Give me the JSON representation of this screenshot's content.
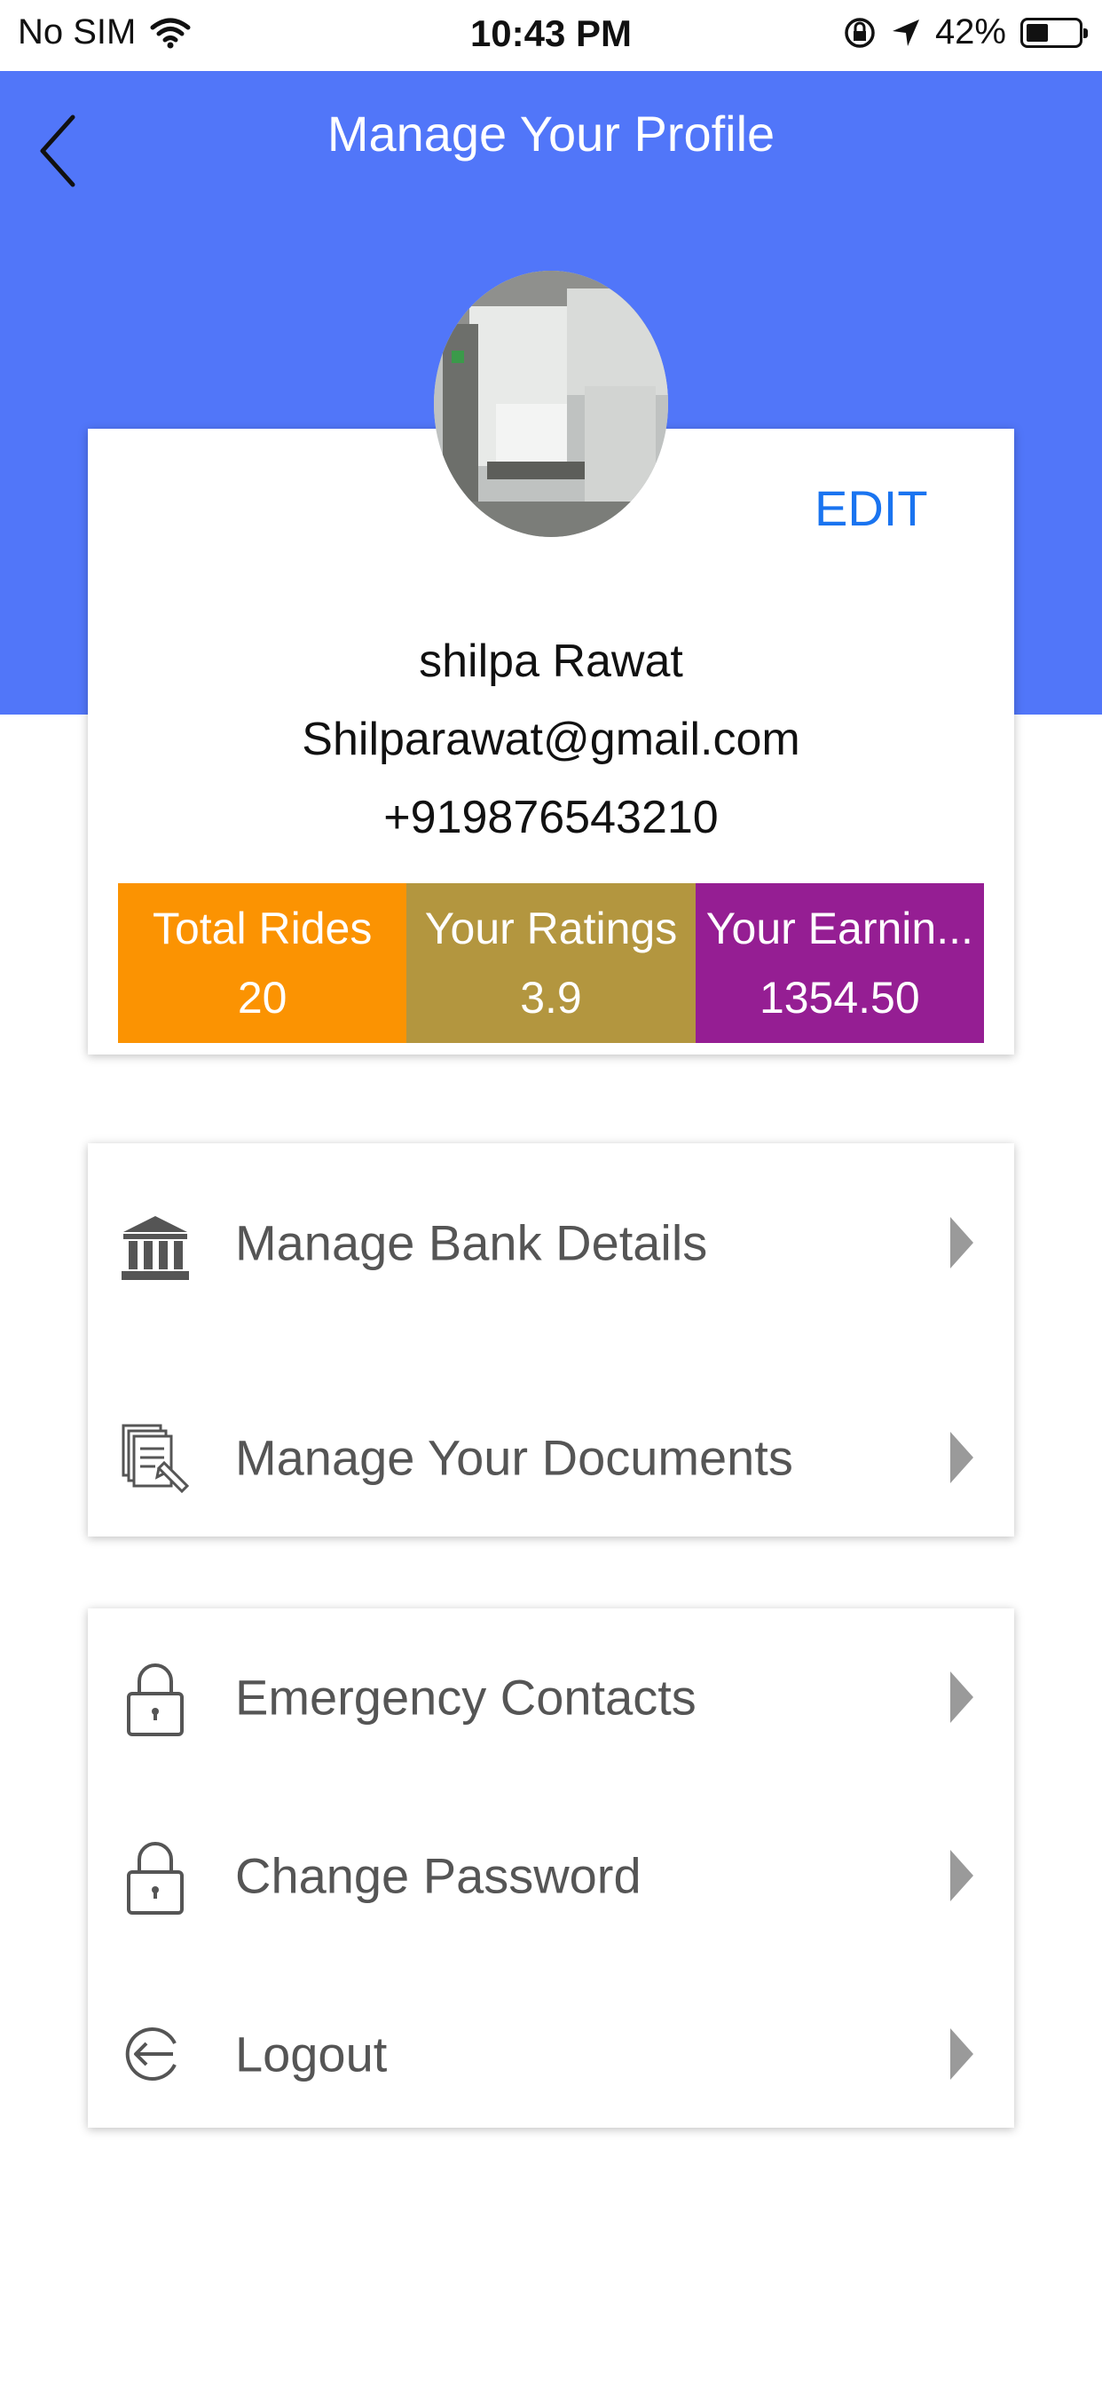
{
  "status_bar": {
    "carrier": "No SIM",
    "time": "10:43 PM",
    "battery": "42%",
    "wifi_icon": "wifi-icon",
    "battery_level": 0.42
  },
  "header": {
    "title": "Manage Your Profile",
    "back_icon": "chevron-left-icon",
    "color": "#5176f9"
  },
  "profile": {
    "edit_label": "EDIT",
    "name": "shilpa Rawat",
    "email": "Shilparawat@gmail.com",
    "phone": "+919876543210"
  },
  "stats": [
    {
      "label": "Total Rides",
      "value": "20",
      "color": "#fb9302"
    },
    {
      "label": "Your Ratings",
      "value": "3.9",
      "color": "#b3963f"
    },
    {
      "label": "Your Earnin...",
      "value": "1354.50",
      "color": "#951e93"
    }
  ],
  "menu_group_1": [
    {
      "label": "Manage Bank Details",
      "icon": "bank-icon"
    },
    {
      "label": "Manage Your Documents",
      "icon": "documents-icon"
    }
  ],
  "menu_group_2": [
    {
      "label": "Emergency Contacts",
      "icon": "lock-icon"
    },
    {
      "label": "Change Password",
      "icon": "lock-icon"
    },
    {
      "label": "Logout",
      "icon": "logout-icon"
    }
  ]
}
